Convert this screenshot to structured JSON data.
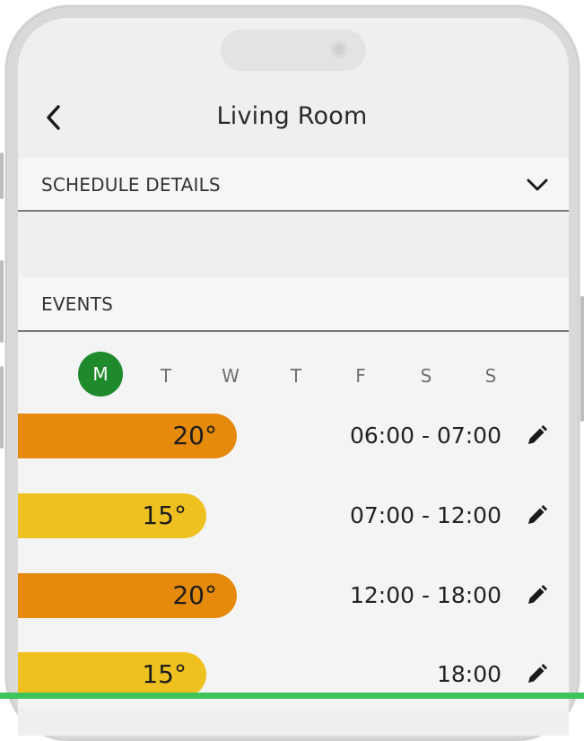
{
  "header": {
    "title": "Living Room"
  },
  "sections": {
    "schedule_details": "SCHEDULE DETAILS",
    "events": "EVENTS"
  },
  "days": [
    "M",
    "T",
    "W",
    "T",
    "F",
    "S",
    "S"
  ],
  "selected_day": "M",
  "events": [
    {
      "temp": "20°",
      "time": "06:00 - 07:00",
      "level": "hot"
    },
    {
      "temp": "15°",
      "time": "07:00 - 12:00",
      "level": "warm"
    },
    {
      "temp": "20°",
      "time": "12:00 - 18:00",
      "level": "hot"
    },
    {
      "temp": "15°",
      "time": "18:00",
      "level": "warm"
    }
  ],
  "colors": {
    "accent_green": "#1f8a2c",
    "hot": "#e68a0c",
    "warm": "#efc120",
    "bottom_bar": "#3dc45a"
  },
  "icons": [
    "back-icon",
    "chevron-down-icon",
    "pencil-icon",
    "camera-icon"
  ]
}
